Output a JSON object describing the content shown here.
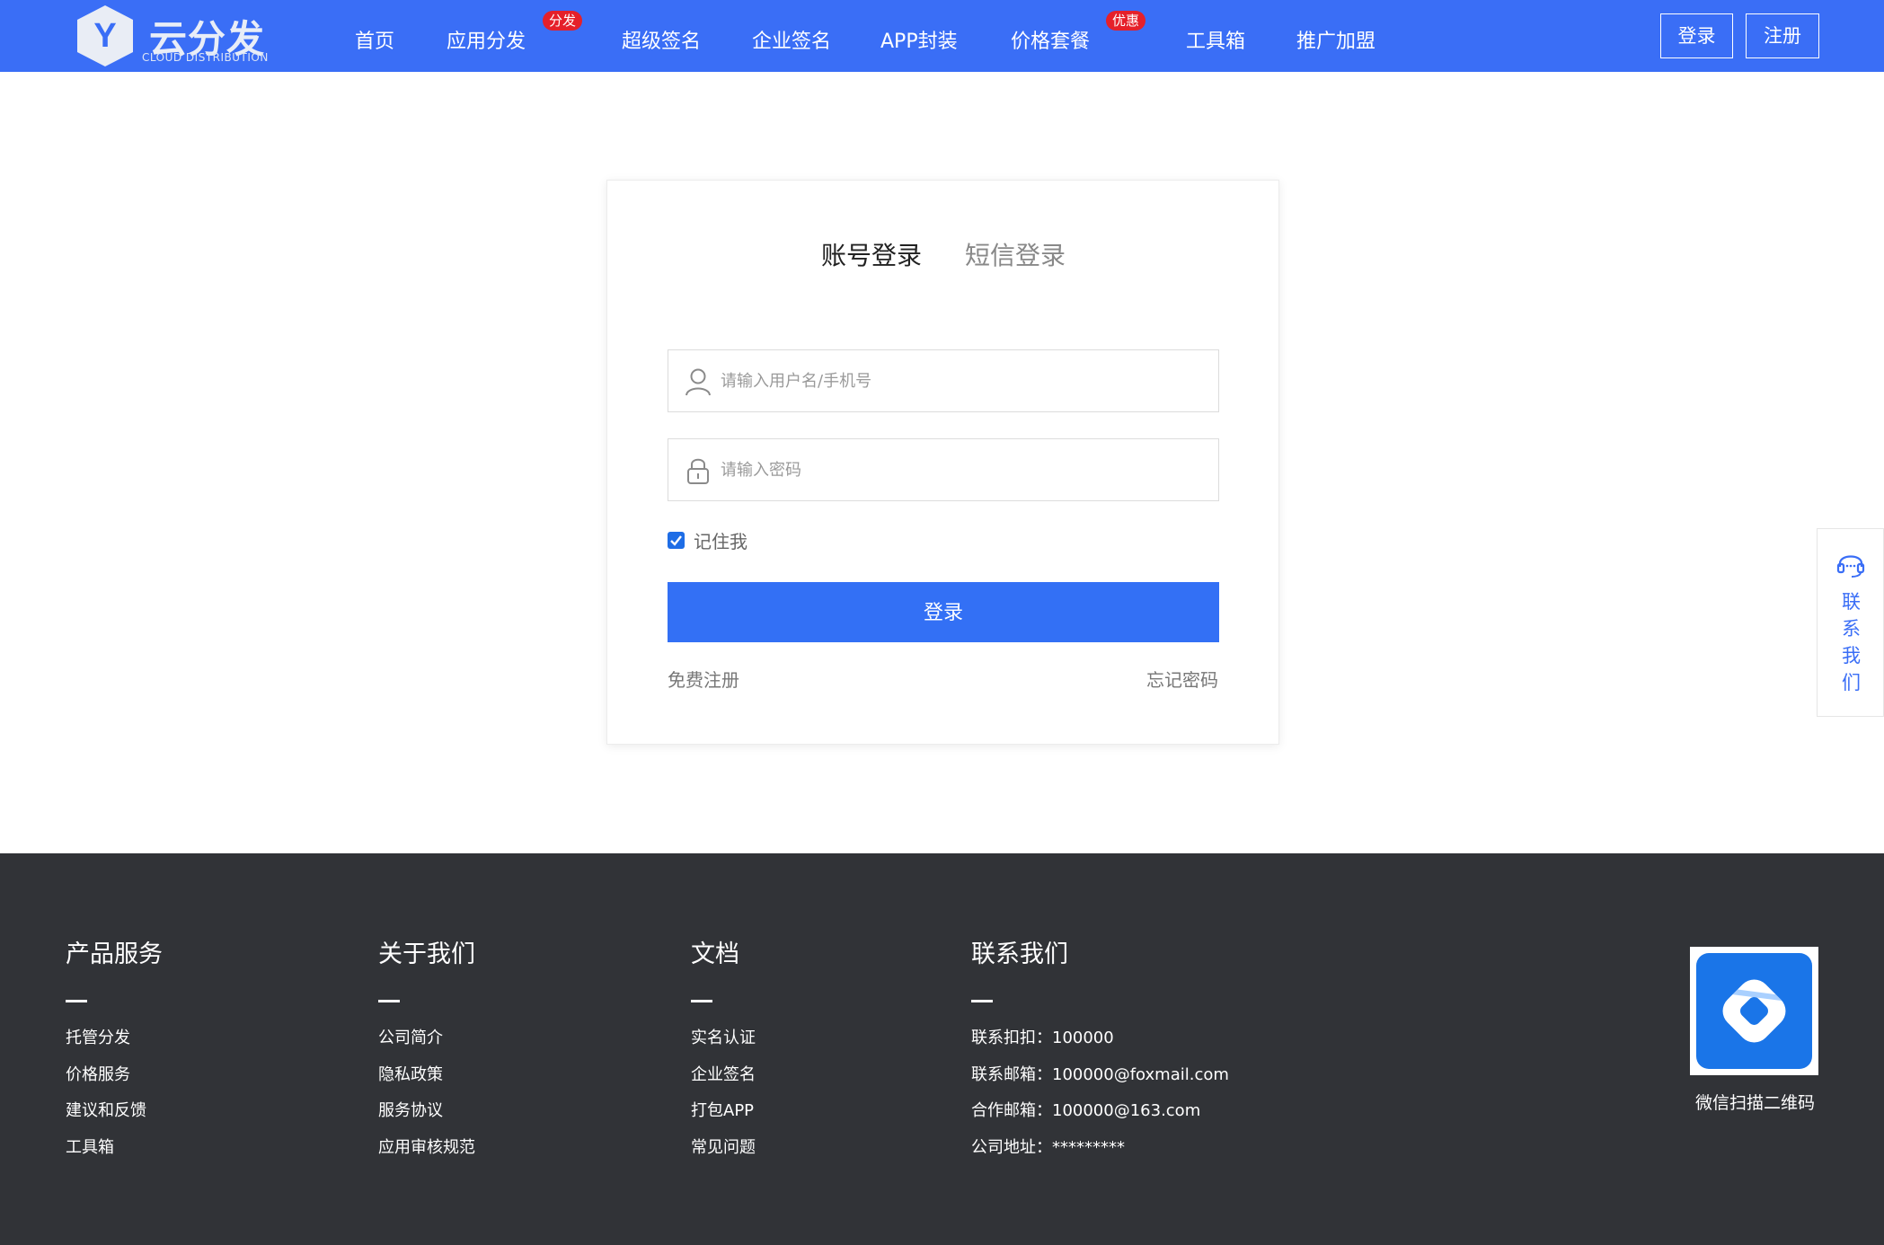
{
  "header": {
    "logo": {
      "text": "云分发",
      "sub": "CLOUD DISTRIBUTION",
      "letter": "Y"
    },
    "nav": [
      {
        "label": "首页"
      },
      {
        "label": "应用分发",
        "badge": "分发"
      },
      {
        "label": "超级签名"
      },
      {
        "label": "企业签名"
      },
      {
        "label": "APP封装"
      },
      {
        "label": "价格套餐",
        "badge": "优惠"
      },
      {
        "label": "工具箱"
      },
      {
        "label": "推广加盟"
      }
    ],
    "login_label": "登录",
    "register_label": "注册"
  },
  "login": {
    "tabs": [
      {
        "label": "账号登录",
        "active": true
      },
      {
        "label": "短信登录",
        "active": false
      }
    ],
    "username_placeholder": "请输入用户名/手机号",
    "password_placeholder": "请输入密码",
    "username_value": "",
    "password_value": "",
    "remember_label": "记住我",
    "remember_checked": true,
    "submit_label": "登录",
    "register_link": "免费注册",
    "forgot_link": "忘记密码"
  },
  "side_contact": {
    "label": "联系我们",
    "icon": "headset-icon"
  },
  "footer": {
    "columns": [
      {
        "title": "产品服务",
        "items": [
          "托管分发",
          "价格服务",
          "建议和反馈",
          "工具箱"
        ]
      },
      {
        "title": "关于我们",
        "items": [
          "公司简介",
          "隐私政策",
          "服务协议",
          "应用审核规范"
        ]
      },
      {
        "title": "文档",
        "items": [
          "实名认证",
          "企业签名",
          "打包APP",
          "常见问题"
        ]
      },
      {
        "title": "联系我们",
        "items": [
          "联系扣扣：100000",
          "联系邮箱：100000@foxmail.com",
          "合作邮箱：100000@163.com",
          "公司地址：*********"
        ]
      }
    ],
    "qr_label": "微信扫描二维码"
  },
  "colors": {
    "header_bg": "#3a6ef6",
    "badge_red": "#e5202a",
    "button_blue": "#3370f5",
    "footer_bg": "#313337",
    "checkbox_blue": "#1e6de6"
  }
}
